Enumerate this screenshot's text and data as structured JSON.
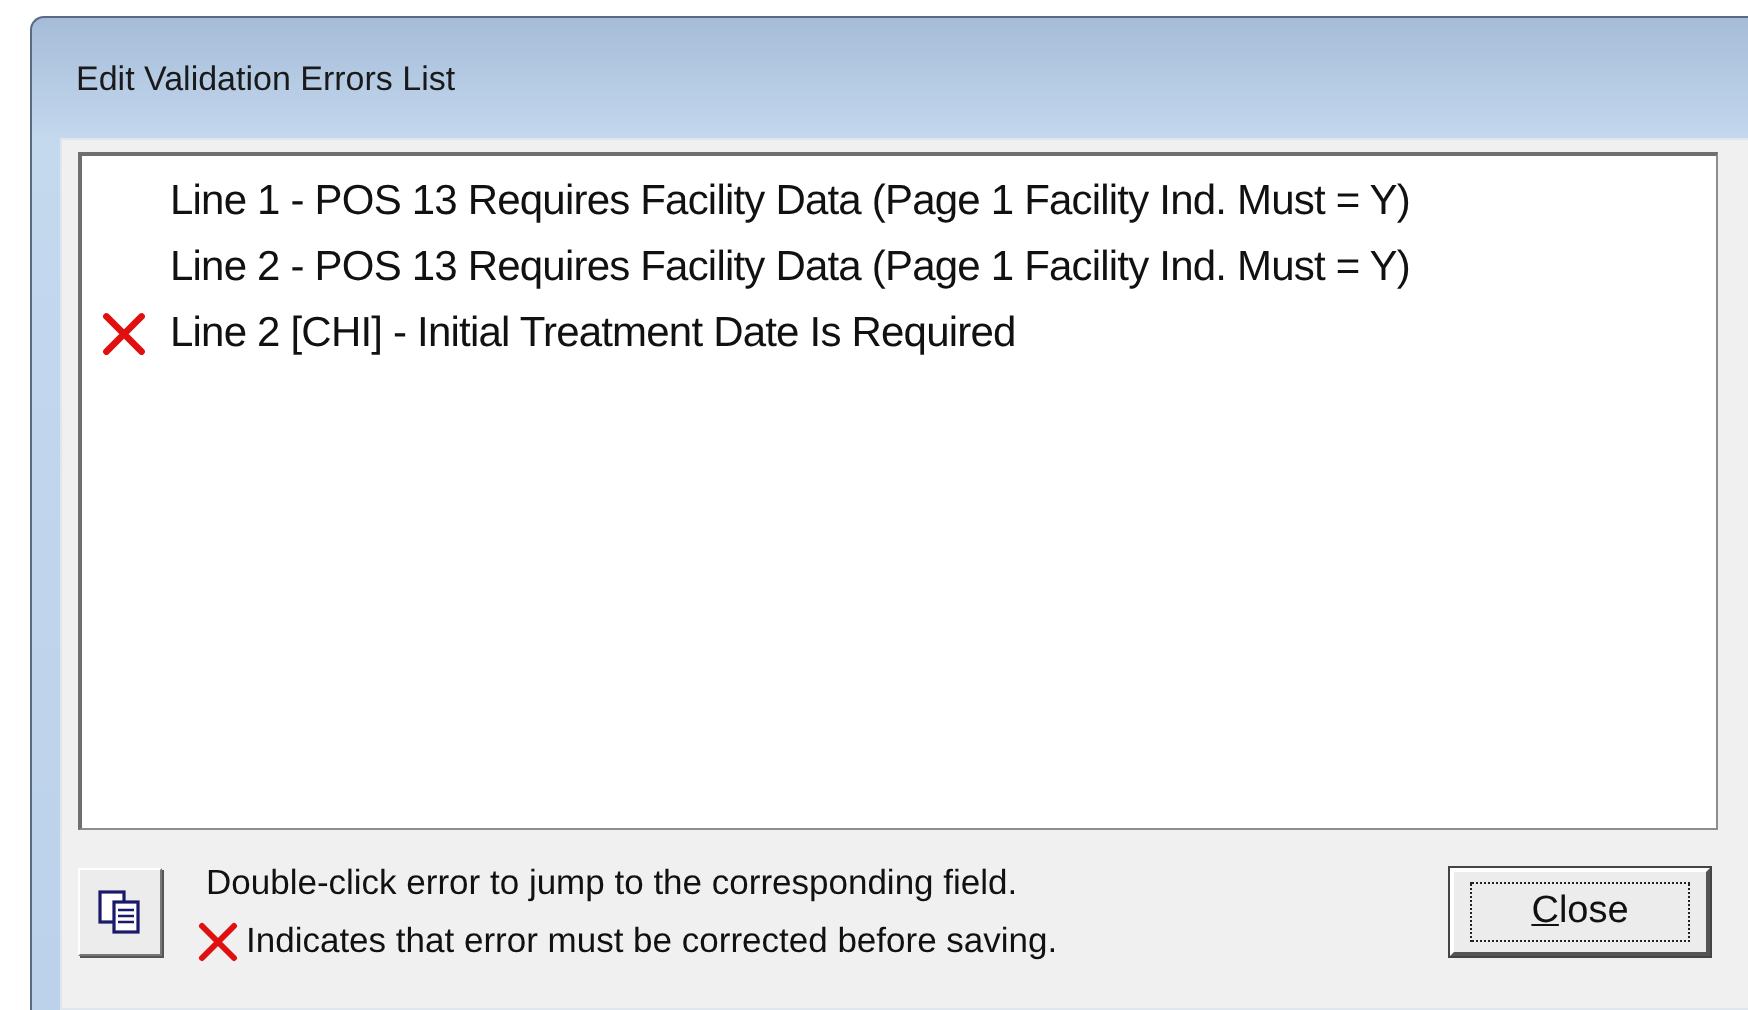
{
  "window": {
    "title": "Edit Validation Errors List"
  },
  "errors": [
    {
      "text": "Line 1 - POS 13 Requires Facility Data (Page 1 Facility Ind. Must = Y)",
      "must_correct": false
    },
    {
      "text": "Line 2 - POS 13 Requires Facility Data (Page 1 Facility Ind. Must = Y)",
      "must_correct": false
    },
    {
      "text": "Line 2 [CHI] - Initial Treatment Date Is Required",
      "must_correct": true
    }
  ],
  "hint": "Double-click error to jump to the corresponding field.",
  "legend": "Indicates that error must be corrected before saving.",
  "close_button": "Close"
}
